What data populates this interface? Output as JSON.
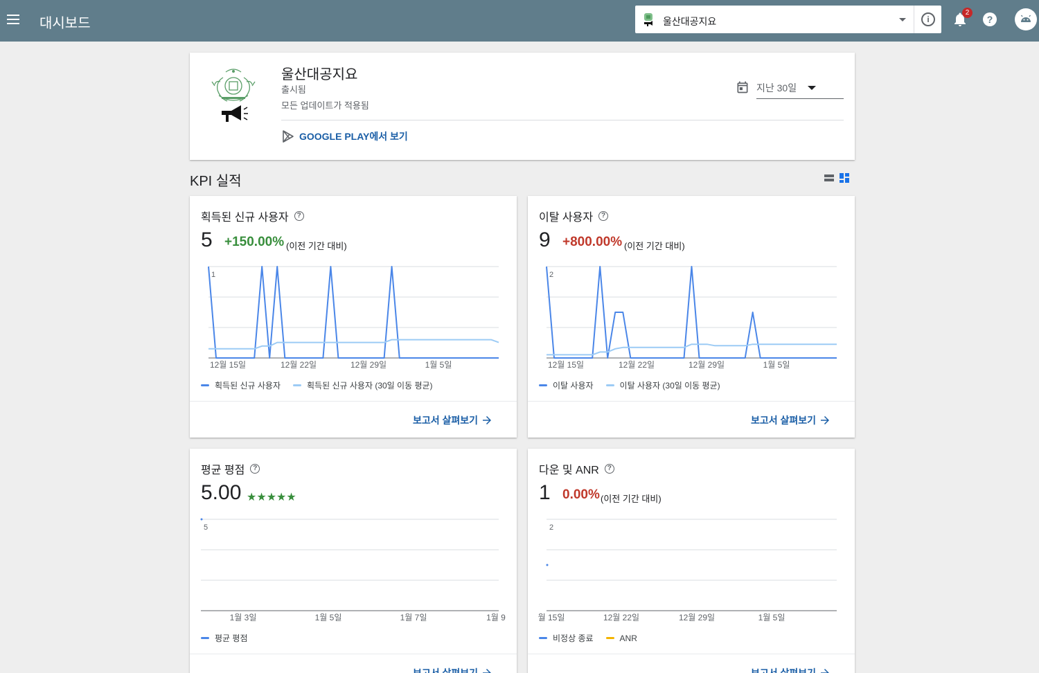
{
  "topbar": {
    "title": "대시보드",
    "app_selector": "울산대공지요",
    "notification_count": "2",
    "help_label": "?"
  },
  "app": {
    "name": "울산대공지요",
    "status": "출시됨",
    "updates": "모든 업데이트가 적용됨",
    "play_link": "GOOGLE PLAY에서 보기",
    "date_range": "지난 30일"
  },
  "section": {
    "title": "KPI 실적"
  },
  "colors": {
    "topbar": "#607d8b",
    "series_primary": "#4a86e8",
    "series_avg": "#9ccbf5",
    "anr": "#f4b400",
    "positive": "#388e3c",
    "negative": "#c0392b",
    "link": "#1a5ea6"
  },
  "kpis": [
    {
      "title": "획득된 신규 사용자",
      "value": "5",
      "delta": "+150.00%",
      "comparison": "(이전 기간 대비)",
      "y_max_label": "1",
      "legend": [
        "획득된 신규 사용자",
        "획득된 신규 사용자 (30일 이동 평균)"
      ],
      "report_link": "보고서 살펴보기"
    },
    {
      "title": "이탈 사용자",
      "value": "9",
      "delta": "+800.00%",
      "comparison": "(이전 기간 대비)",
      "y_max_label": "2",
      "legend": [
        "이탈 사용자",
        "이탈 사용자 (30일 이동 평균)"
      ],
      "report_link": "보고서 살펴보기"
    },
    {
      "title": "평균 평점",
      "value": "5.00",
      "stars": "★★★★★",
      "y_max_label": "5",
      "legend": [
        "평균 평점"
      ],
      "report_link": "보고서 살펴보기"
    },
    {
      "title": "다운 및 ANR",
      "value": "1",
      "delta": "0.00%",
      "comparison": "(이전 기간 대비)",
      "y_max_label": "2",
      "legend": [
        "비정상 종료",
        "ANR"
      ],
      "report_link": "보고서 살펴보기"
    }
  ],
  "chart_data": [
    {
      "type": "line",
      "title": "획득된 신규 사용자",
      "x_tick_labels": [
        "12월 15일",
        "12월 22일",
        "12월 29일",
        "1월 5일"
      ],
      "ylim": [
        0,
        1
      ],
      "grid": true,
      "legend_placement": "bottom",
      "series": [
        {
          "name": "획득된 신규 사용자",
          "values": [
            1,
            0,
            0,
            0,
            0,
            0,
            0,
            1,
            0,
            1,
            0,
            0,
            0,
            0,
            0,
            0,
            1,
            0,
            0,
            0,
            0,
            0,
            0,
            0,
            1,
            0,
            0,
            0,
            0,
            0,
            0,
            0,
            0,
            0,
            0,
            0,
            0,
            0,
            0
          ]
        },
        {
          "name": "획득된 신규 사용자 (30일 이동 평균)",
          "values": [
            0.1,
            0.1,
            0.1,
            0.1,
            0.1,
            0.1,
            0.1,
            0.13,
            0.13,
            0.17,
            0.17,
            0.17,
            0.17,
            0.17,
            0.17,
            0.17,
            0.17,
            0.17,
            0.17,
            0.17,
            0.17,
            0.17,
            0.17,
            0.17,
            0.2,
            0.2,
            0.2,
            0.2,
            0.2,
            0.2,
            0.2,
            0.2,
            0.2,
            0.2,
            0.2,
            0.2,
            0.2,
            0.2,
            0.17
          ]
        }
      ]
    },
    {
      "type": "line",
      "title": "이탈 사용자",
      "x_tick_labels": [
        "12월 15일",
        "12월 22일",
        "12월 29일",
        "1월 5일"
      ],
      "ylim": [
        0,
        2
      ],
      "grid": true,
      "legend_placement": "bottom",
      "series": [
        {
          "name": "이탈 사용자",
          "values": [
            2,
            0,
            0,
            0,
            0,
            0,
            0,
            2,
            0,
            1,
            1,
            0,
            0,
            0,
            0,
            0,
            0,
            0,
            0,
            2,
            0,
            0,
            0,
            0,
            0,
            0,
            0,
            1,
            0,
            0,
            0,
            0,
            0,
            0,
            0,
            0,
            0,
            0,
            0
          ]
        },
        {
          "name": "이탈 사용자 (30일 이동 평균)",
          "values": [
            0.07,
            0.07,
            0.07,
            0.07,
            0.07,
            0.07,
            0.07,
            0.13,
            0.13,
            0.2,
            0.23,
            0.23,
            0.23,
            0.23,
            0.23,
            0.23,
            0.23,
            0.23,
            0.23,
            0.3,
            0.3,
            0.3,
            0.27,
            0.27,
            0.27,
            0.27,
            0.27,
            0.3,
            0.3,
            0.3,
            0.3,
            0.3,
            0.3,
            0.3,
            0.3,
            0.3,
            0.3,
            0.3,
            0.3
          ]
        }
      ]
    },
    {
      "type": "line",
      "title": "평균 평점",
      "x_tick_labels": [
        "1월 3일",
        "1월 5일",
        "1월 7일",
        "1월 9"
      ],
      "ylim": [
        0,
        5
      ],
      "grid": true,
      "legend_placement": "bottom",
      "series": [
        {
          "name": "평균 평점",
          "points": [
            {
              "x": "1월 2일",
              "y": 5
            }
          ]
        }
      ]
    },
    {
      "type": "line",
      "title": "다운 및 ANR",
      "x_tick_labels": [
        "월 15일",
        "12월 22일",
        "12월 29일",
        "1월 5일"
      ],
      "ylim": [
        0,
        2
      ],
      "grid": true,
      "legend_placement": "bottom",
      "series": [
        {
          "name": "비정상 종료",
          "points": [
            {
              "x": "12월 14일",
              "y": 1
            }
          ]
        },
        {
          "name": "ANR",
          "values": []
        }
      ]
    }
  ]
}
